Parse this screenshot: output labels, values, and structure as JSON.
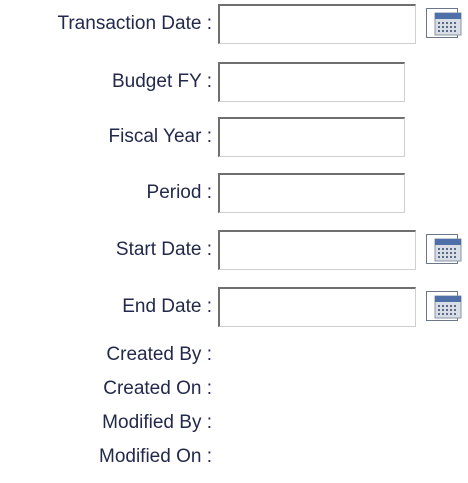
{
  "fields": [
    {
      "label": "Transaction Date :",
      "value": "",
      "has_calendar": true
    },
    {
      "label": "Budget FY :",
      "value": "",
      "has_calendar": false
    },
    {
      "label": "Fiscal Year :",
      "value": "",
      "has_calendar": false
    },
    {
      "label": "Period :",
      "value": "",
      "has_calendar": false
    },
    {
      "label": "Start Date :",
      "value": "",
      "has_calendar": true
    },
    {
      "label": "End Date :",
      "value": "",
      "has_calendar": true
    }
  ],
  "audit": {
    "created_by_label": "Created By :",
    "created_on_label": "Created On :",
    "modified_by_label": "Modified By :",
    "modified_on_label": "Modified On :"
  },
  "icons": {
    "calendar": "calendar-icon"
  },
  "colors": {
    "label_text": "#22294a",
    "calendar_header": "#4f6fa8",
    "calendar_body": "#d8dde6"
  }
}
